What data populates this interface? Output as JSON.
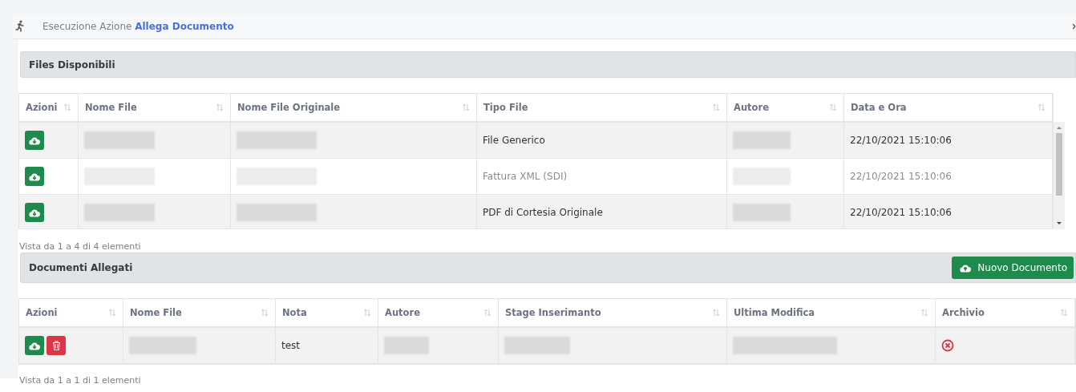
{
  "header": {
    "prefix": "Esecuzione Azione",
    "action": "Allega Documento"
  },
  "files_section": {
    "title": "Files Disponibili",
    "columns": [
      "Azioni",
      "Nome File",
      "Nome File Originale",
      "Tipo File",
      "Autore",
      "Data e Ora"
    ],
    "rows": [
      {
        "muted": false,
        "cells": [
          {
            "kind": "actions",
            "buttons": [
              {
                "kind": "download"
              }
            ]
          },
          {
            "kind": "blurred"
          },
          {
            "kind": "blurred"
          },
          {
            "kind": "text",
            "text": "File Generico"
          },
          {
            "kind": "blurred"
          },
          {
            "kind": "text",
            "text": "22/10/2021 15:10:06"
          }
        ]
      },
      {
        "muted": true,
        "cells": [
          {
            "kind": "actions",
            "buttons": [
              {
                "kind": "download"
              }
            ]
          },
          {
            "kind": "blurred"
          },
          {
            "kind": "blurred"
          },
          {
            "kind": "text",
            "text": "Fattura XML (SDI)"
          },
          {
            "kind": "blurred"
          },
          {
            "kind": "text",
            "text": "22/10/2021 15:10:06"
          }
        ]
      },
      {
        "muted": false,
        "cells": [
          {
            "kind": "actions",
            "buttons": [
              {
                "kind": "download"
              }
            ]
          },
          {
            "kind": "blurred"
          },
          {
            "kind": "blurred"
          },
          {
            "kind": "text",
            "text": "PDF di Cortesia Originale"
          },
          {
            "kind": "blurred"
          },
          {
            "kind": "text",
            "text": "22/10/2021 15:10:06"
          }
        ]
      }
    ],
    "info": "Vista da 1 a 4 di 4 elementi"
  },
  "documents_section": {
    "title": "Documenti Allegati",
    "new_button": "Nuovo Documento",
    "columns": [
      "Azioni",
      "Nome File",
      "Nota",
      "Autore",
      "Stage Inserimanto",
      "Ultima Modifica",
      "Archivio"
    ],
    "rows": [
      {
        "muted": false,
        "cells": [
          {
            "kind": "actions",
            "buttons": [
              {
                "kind": "download"
              },
              {
                "kind": "delete"
              }
            ]
          },
          {
            "kind": "blurred"
          },
          {
            "kind": "text",
            "text": "test"
          },
          {
            "kind": "blurred"
          },
          {
            "kind": "blurred"
          },
          {
            "kind": "blurred"
          },
          {
            "kind": "archive",
            "archived": false
          }
        ]
      }
    ],
    "info": "Vista da 1 a 1 di 1 elementi"
  }
}
